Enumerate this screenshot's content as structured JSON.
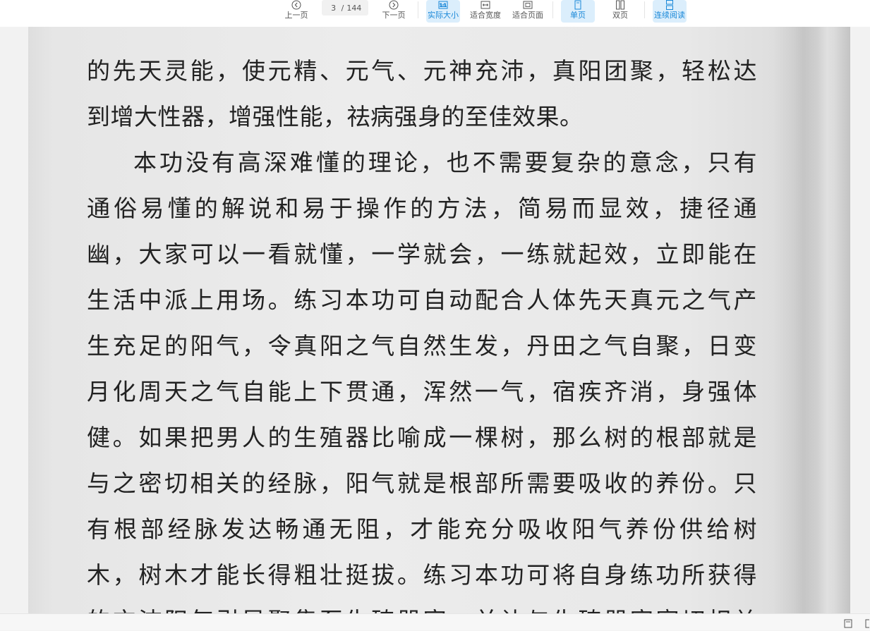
{
  "toolbar": {
    "prev_label": "上一页",
    "next_label": "下一页",
    "current_page": "3",
    "separator": "/",
    "total_pages": "144",
    "actual_size_label": "实际大小",
    "fit_width_label": "适合宽度",
    "fit_page_label": "适合页面",
    "single_page_label": "单页",
    "double_page_label": "双页",
    "continuous_label": "连续阅读",
    "active_color": "#1a88d8"
  },
  "document": {
    "lines": [
      "的先天灵能，使元精、元气、元神充沛，真阳团聚，轻松达",
      "到增大性器，增强性能，祛病强身的至佳效果。",
      "本功没有高深难懂的理论，也不需要复杂的意念，只有",
      "通俗易懂的解说和易于操作的方法，简易而显效，捷径通",
      "幽，大家可以一看就懂，一学就会，一练就起效，立即能在",
      "生活中派上用场。练习本功可自动配合人体先天真元之气产",
      "生充足的阳气，令真阳之气自然生发，丹田之气自聚，日变",
      "月化周天之气自能上下贯通，浑然一气，宿疾齐消，身强体",
      "健。如果把男人的生殖器比喻成一棵树，那么树的根部就是",
      "与之密切相关的经脉，阳气就是根部所需要吸收的养份。只",
      "有根部经脉发达畅通无阻，才能充分吸收阳气养份供给树",
      "木，树木才能长得粗壮挺拔。练习本功可将自身练功所获得",
      "的充沛阳气引导聚集至生殖器官，并让与生殖器官密切相关"
    ]
  }
}
